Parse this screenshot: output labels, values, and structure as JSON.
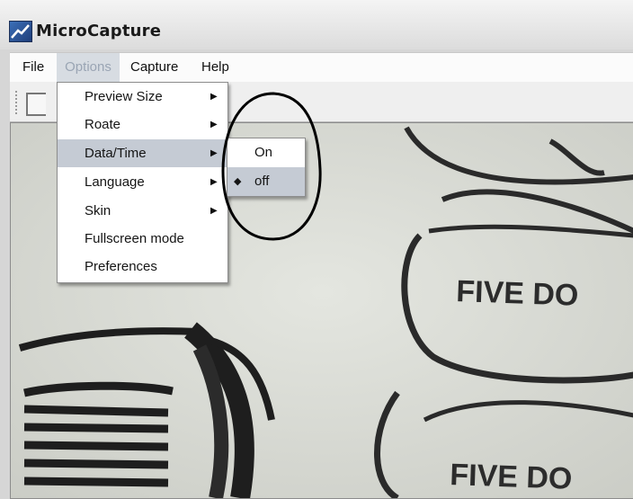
{
  "window": {
    "title": "MicroCapture"
  },
  "menubar": {
    "items": [
      "File",
      "Options",
      "Capture",
      "Help"
    ]
  },
  "options_menu": {
    "items": [
      {
        "label": "Preview Size",
        "submenu": true
      },
      {
        "label": "Roate",
        "submenu": true
      },
      {
        "label": "Data/Time",
        "submenu": true,
        "highlighted": true
      },
      {
        "label": "Language",
        "submenu": true
      },
      {
        "label": "Skin",
        "submenu": true
      },
      {
        "label": "Fullscreen mode",
        "submenu": false
      },
      {
        "label": "Preferences",
        "submenu": false
      }
    ]
  },
  "datetime_submenu": {
    "items": [
      {
        "label": "On",
        "checked": false
      },
      {
        "label": "off",
        "checked": true,
        "highlighted": true
      }
    ],
    "check_mark": "◆"
  },
  "icons": {
    "submenu_arrow": "▶"
  },
  "preview": {
    "printed_text": [
      "FIVE DO",
      "FIVE DO"
    ]
  },
  "colors": {
    "menu_highlight": "#c5cbd4",
    "annotation_circle": "#000000"
  }
}
